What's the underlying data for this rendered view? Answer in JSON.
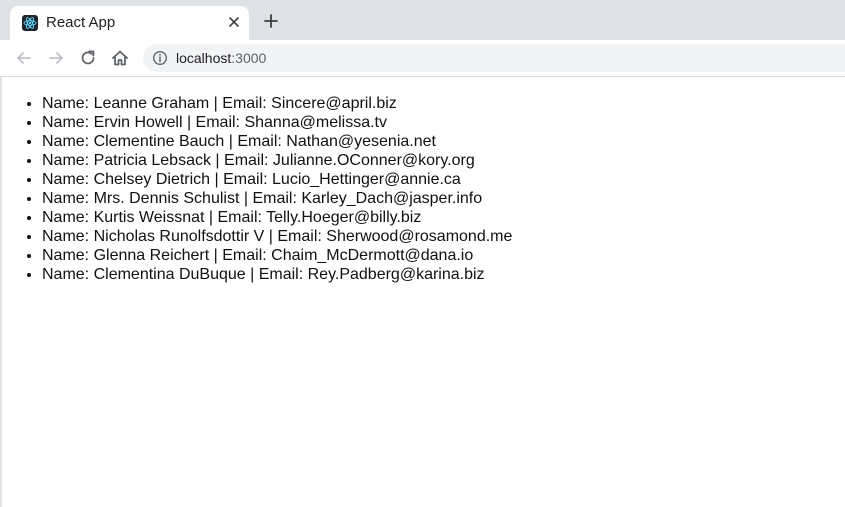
{
  "browser": {
    "tab": {
      "title": "React App",
      "favicon": "react-logo-icon"
    },
    "toolbar": {
      "back_icon": "arrow-left-icon",
      "forward_icon": "arrow-right-icon",
      "reload_icon": "reload-icon",
      "home_icon": "home-icon"
    },
    "omnibox": {
      "host": "localhost",
      "port": ":3000",
      "icon": "info-icon"
    }
  },
  "users": [
    {
      "name": "Leanne Graham",
      "email": "Sincere@april.biz"
    },
    {
      "name": "Ervin Howell",
      "email": "Shanna@melissa.tv"
    },
    {
      "name": "Clementine Bauch",
      "email": "Nathan@yesenia.net"
    },
    {
      "name": "Patricia Lebsack",
      "email": "Julianne.OConner@kory.org"
    },
    {
      "name": "Chelsey Dietrich",
      "email": "Lucio_Hettinger@annie.ca"
    },
    {
      "name": "Mrs. Dennis Schulist",
      "email": "Karley_Dach@jasper.info"
    },
    {
      "name": "Kurtis Weissnat",
      "email": "Telly.Hoeger@billy.biz"
    },
    {
      "name": "Nicholas Runolfsdottir V",
      "email": "Sherwood@rosamond.me"
    },
    {
      "name": "Glenna Reichert",
      "email": "Chaim_McDermott@dana.io"
    },
    {
      "name": "Clementina DuBuque",
      "email": "Rey.Padberg@karina.biz"
    }
  ],
  "list_labels": {
    "name_prefix": "Name: ",
    "separator": " | ",
    "email_prefix": "Email: "
  },
  "colors": {
    "tabstrip": "#dee1e6",
    "omnibox": "#f1f3f4",
    "text": "#111111"
  }
}
